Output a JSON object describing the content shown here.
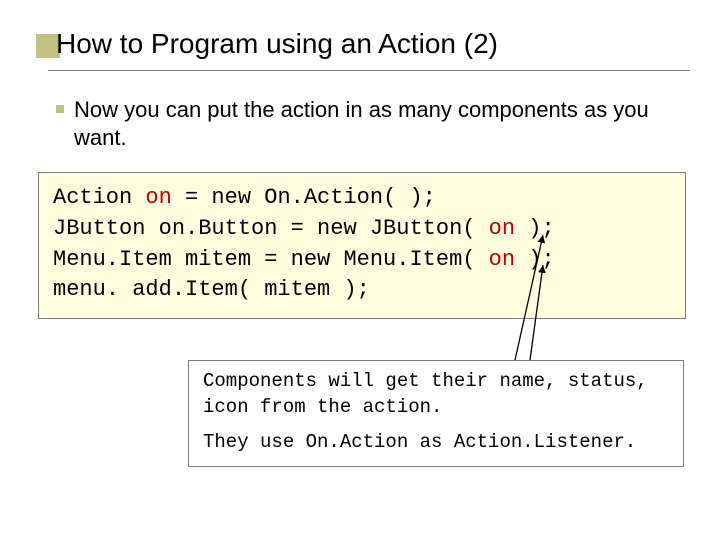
{
  "title": "How to Program using an Action (2)",
  "body": "Now you can put the action in as many components as you want.",
  "code": {
    "l1a": "Action ",
    "l1b": "on",
    "l1c": " = new On.Action( );",
    "l2a": "JButton on.Button = new JButton( ",
    "l2b": "on",
    "l2c": " );",
    "l3a": "Menu.Item mitem = new Menu.Item( ",
    "l3b": "on",
    "l3c": " );",
    "l4": "menu. add.Item( mitem );"
  },
  "note": {
    "p1": "Components will get their name, status, icon from the action.",
    "p2": "They use On.Action as Action.Listener."
  }
}
